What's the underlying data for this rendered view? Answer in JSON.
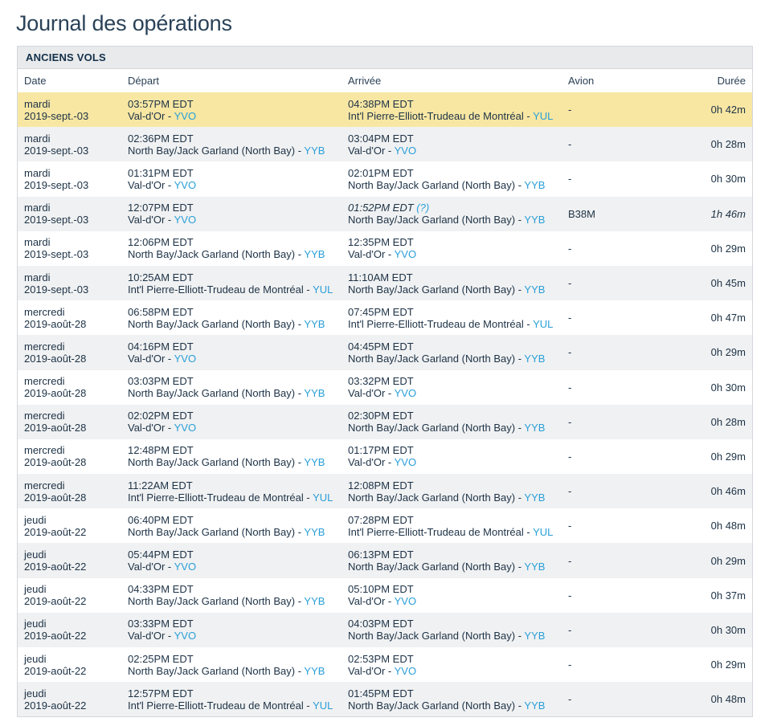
{
  "page": {
    "title": "Journal des opérations"
  },
  "panel": {
    "header": "ANCIENS VOLS",
    "columns": {
      "date": "Date",
      "depart": "Départ",
      "arrivee": "Arrivée",
      "avion": "Avion",
      "duree": "Durée"
    }
  },
  "flights": [
    {
      "day": "mardi",
      "date": "2019-sept.-03",
      "dep_time": "03:57PM EDT",
      "dep_airport": "Val-d'Or - ",
      "dep_code": "YVO",
      "arr_time": "04:38PM EDT",
      "arr_airport": "Int'l Pierre-Elliott-Trudeau de Montréal - ",
      "arr_code": "YUL",
      "aircraft": "-",
      "duration": "0h 42m",
      "highlighted": true,
      "estimated": false
    },
    {
      "day": "mardi",
      "date": "2019-sept.-03",
      "dep_time": "02:36PM EDT",
      "dep_airport": "North Bay/Jack Garland (North Bay) - ",
      "dep_code": "YYB",
      "arr_time": "03:04PM EDT",
      "arr_airport": "Val-d'Or - ",
      "arr_code": "YVO",
      "aircraft": "-",
      "duration": "0h 28m",
      "highlighted": false,
      "estimated": false
    },
    {
      "day": "mardi",
      "date": "2019-sept.-03",
      "dep_time": "01:31PM EDT",
      "dep_airport": "Val-d'Or - ",
      "dep_code": "YVO",
      "arr_time": "02:01PM EDT",
      "arr_airport": "North Bay/Jack Garland (North Bay) - ",
      "arr_code": "YYB",
      "aircraft": "-",
      "duration": "0h 30m",
      "highlighted": false,
      "estimated": false
    },
    {
      "day": "mardi",
      "date": "2019-sept.-03",
      "dep_time": "12:07PM EDT",
      "dep_airport": "Val-d'Or - ",
      "dep_code": "YVO",
      "arr_time": "01:52PM EDT",
      "arr_help": "(?)",
      "arr_airport": "North Bay/Jack Garland (North Bay) - ",
      "arr_code": "YYB",
      "aircraft": "B38M",
      "duration": "1h 46m",
      "highlighted": false,
      "estimated": true
    },
    {
      "day": "mardi",
      "date": "2019-sept.-03",
      "dep_time": "12:06PM EDT",
      "dep_airport": "North Bay/Jack Garland (North Bay) - ",
      "dep_code": "YYB",
      "arr_time": "12:35PM EDT",
      "arr_airport": "Val-d'Or - ",
      "arr_code": "YVO",
      "aircraft": "-",
      "duration": "0h 29m",
      "highlighted": false,
      "estimated": false
    },
    {
      "day": "mardi",
      "date": "2019-sept.-03",
      "dep_time": "10:25AM EDT",
      "dep_airport": "Int'l Pierre-Elliott-Trudeau de Montréal - ",
      "dep_code": "YUL",
      "arr_time": "11:10AM EDT",
      "arr_airport": "North Bay/Jack Garland (North Bay) - ",
      "arr_code": "YYB",
      "aircraft": "-",
      "duration": "0h 45m",
      "highlighted": false,
      "estimated": false
    },
    {
      "day": "mercredi",
      "date": "2019-août-28",
      "dep_time": "06:58PM EDT",
      "dep_airport": "North Bay/Jack Garland (North Bay) - ",
      "dep_code": "YYB",
      "arr_time": "07:45PM EDT",
      "arr_airport": "Int'l Pierre-Elliott-Trudeau de Montréal - ",
      "arr_code": "YUL",
      "aircraft": "-",
      "duration": "0h 47m",
      "highlighted": false,
      "estimated": false
    },
    {
      "day": "mercredi",
      "date": "2019-août-28",
      "dep_time": "04:16PM EDT",
      "dep_airport": "Val-d'Or - ",
      "dep_code": "YVO",
      "arr_time": "04:45PM EDT",
      "arr_airport": "North Bay/Jack Garland (North Bay) - ",
      "arr_code": "YYB",
      "aircraft": "-",
      "duration": "0h 29m",
      "highlighted": false,
      "estimated": false
    },
    {
      "day": "mercredi",
      "date": "2019-août-28",
      "dep_time": "03:03PM EDT",
      "dep_airport": "North Bay/Jack Garland (North Bay) - ",
      "dep_code": "YYB",
      "arr_time": "03:32PM EDT",
      "arr_airport": "Val-d'Or - ",
      "arr_code": "YVO",
      "aircraft": "-",
      "duration": "0h 30m",
      "highlighted": false,
      "estimated": false
    },
    {
      "day": "mercredi",
      "date": "2019-août-28",
      "dep_time": "02:02PM EDT",
      "dep_airport": "Val-d'Or - ",
      "dep_code": "YVO",
      "arr_time": "02:30PM EDT",
      "arr_airport": "North Bay/Jack Garland (North Bay) - ",
      "arr_code": "YYB",
      "aircraft": "-",
      "duration": "0h 28m",
      "highlighted": false,
      "estimated": false
    },
    {
      "day": "mercredi",
      "date": "2019-août-28",
      "dep_time": "12:48PM EDT",
      "dep_airport": "North Bay/Jack Garland (North Bay) - ",
      "dep_code": "YYB",
      "arr_time": "01:17PM EDT",
      "arr_airport": "Val-d'Or - ",
      "arr_code": "YVO",
      "aircraft": "-",
      "duration": "0h 29m",
      "highlighted": false,
      "estimated": false
    },
    {
      "day": "mercredi",
      "date": "2019-août-28",
      "dep_time": "11:22AM EDT",
      "dep_airport": "Int'l Pierre-Elliott-Trudeau de Montréal - ",
      "dep_code": "YUL",
      "arr_time": "12:08PM EDT",
      "arr_airport": "North Bay/Jack Garland (North Bay) - ",
      "arr_code": "YYB",
      "aircraft": "-",
      "duration": "0h 46m",
      "highlighted": false,
      "estimated": false
    },
    {
      "day": "jeudi",
      "date": "2019-août-22",
      "dep_time": "06:40PM EDT",
      "dep_airport": "North Bay/Jack Garland (North Bay) - ",
      "dep_code": "YYB",
      "arr_time": "07:28PM EDT",
      "arr_airport": "Int'l Pierre-Elliott-Trudeau de Montréal - ",
      "arr_code": "YUL",
      "aircraft": "-",
      "duration": "0h 48m",
      "highlighted": false,
      "estimated": false
    },
    {
      "day": "jeudi",
      "date": "2019-août-22",
      "dep_time": "05:44PM EDT",
      "dep_airport": "Val-d'Or - ",
      "dep_code": "YVO",
      "arr_time": "06:13PM EDT",
      "arr_airport": "North Bay/Jack Garland (North Bay) - ",
      "arr_code": "YYB",
      "aircraft": "-",
      "duration": "0h 29m",
      "highlighted": false,
      "estimated": false
    },
    {
      "day": "jeudi",
      "date": "2019-août-22",
      "dep_time": "04:33PM EDT",
      "dep_airport": "North Bay/Jack Garland (North Bay) - ",
      "dep_code": "YYB",
      "arr_time": "05:10PM EDT",
      "arr_airport": "Val-d'Or - ",
      "arr_code": "YVO",
      "aircraft": "-",
      "duration": "0h 37m",
      "highlighted": false,
      "estimated": false
    },
    {
      "day": "jeudi",
      "date": "2019-août-22",
      "dep_time": "03:33PM EDT",
      "dep_airport": "Val-d'Or - ",
      "dep_code": "YVO",
      "arr_time": "04:03PM EDT",
      "arr_airport": "North Bay/Jack Garland (North Bay) - ",
      "arr_code": "YYB",
      "aircraft": "-",
      "duration": "0h 30m",
      "highlighted": false,
      "estimated": false
    },
    {
      "day": "jeudi",
      "date": "2019-août-22",
      "dep_time": "02:25PM EDT",
      "dep_airport": "North Bay/Jack Garland (North Bay) - ",
      "dep_code": "YYB",
      "arr_time": "02:53PM EDT",
      "arr_airport": "Val-d'Or - ",
      "arr_code": "YVO",
      "aircraft": "-",
      "duration": "0h 29m",
      "highlighted": false,
      "estimated": false
    },
    {
      "day": "jeudi",
      "date": "2019-août-22",
      "dep_time": "12:57PM EDT",
      "dep_airport": "Int'l Pierre-Elliott-Trudeau de Montréal - ",
      "dep_code": "YUL",
      "arr_time": "01:45PM EDT",
      "arr_airport": "North Bay/Jack Garland (North Bay) - ",
      "arr_code": "YYB",
      "aircraft": "-",
      "duration": "0h 48m",
      "highlighted": false,
      "estimated": false
    }
  ]
}
